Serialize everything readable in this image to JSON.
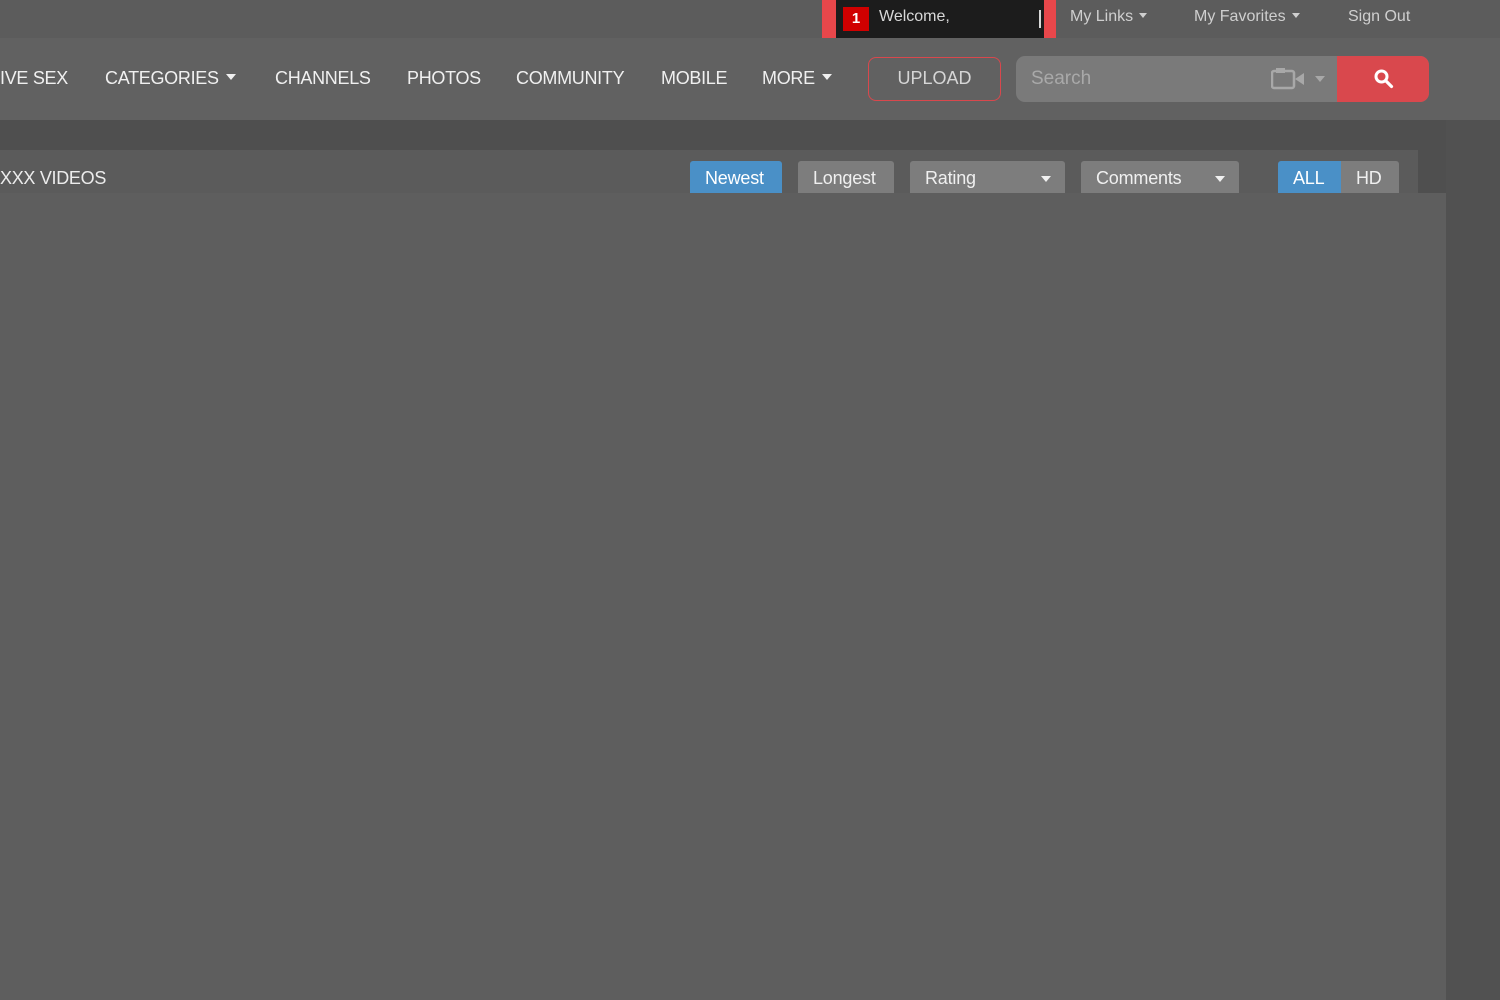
{
  "top_bar": {
    "notification_count": "1",
    "welcome_text": "Welcome,",
    "my_links": "My Links",
    "my_favorites": "My Favorites",
    "sign_out": "Sign Out"
  },
  "nav": {
    "items": [
      "IVE SEX",
      "CATEGORIES",
      "CHANNELS",
      "PHOTOS",
      "COMMUNITY",
      "MOBILE",
      "MORE"
    ],
    "upload": "UPLOAD"
  },
  "search": {
    "placeholder": "Search"
  },
  "section": {
    "title": "XXX VIDEOS"
  },
  "filters": {
    "newest": "Newest",
    "longest": "Longest",
    "rating": "Rating",
    "comments": "Comments",
    "all": "ALL",
    "hd": "HD"
  },
  "colors": {
    "accent_red": "#d9484d",
    "accent_blue": "#4a90c7"
  },
  "icons": [
    "camera-icon",
    "search-icon",
    "chevron-down-icon"
  ]
}
